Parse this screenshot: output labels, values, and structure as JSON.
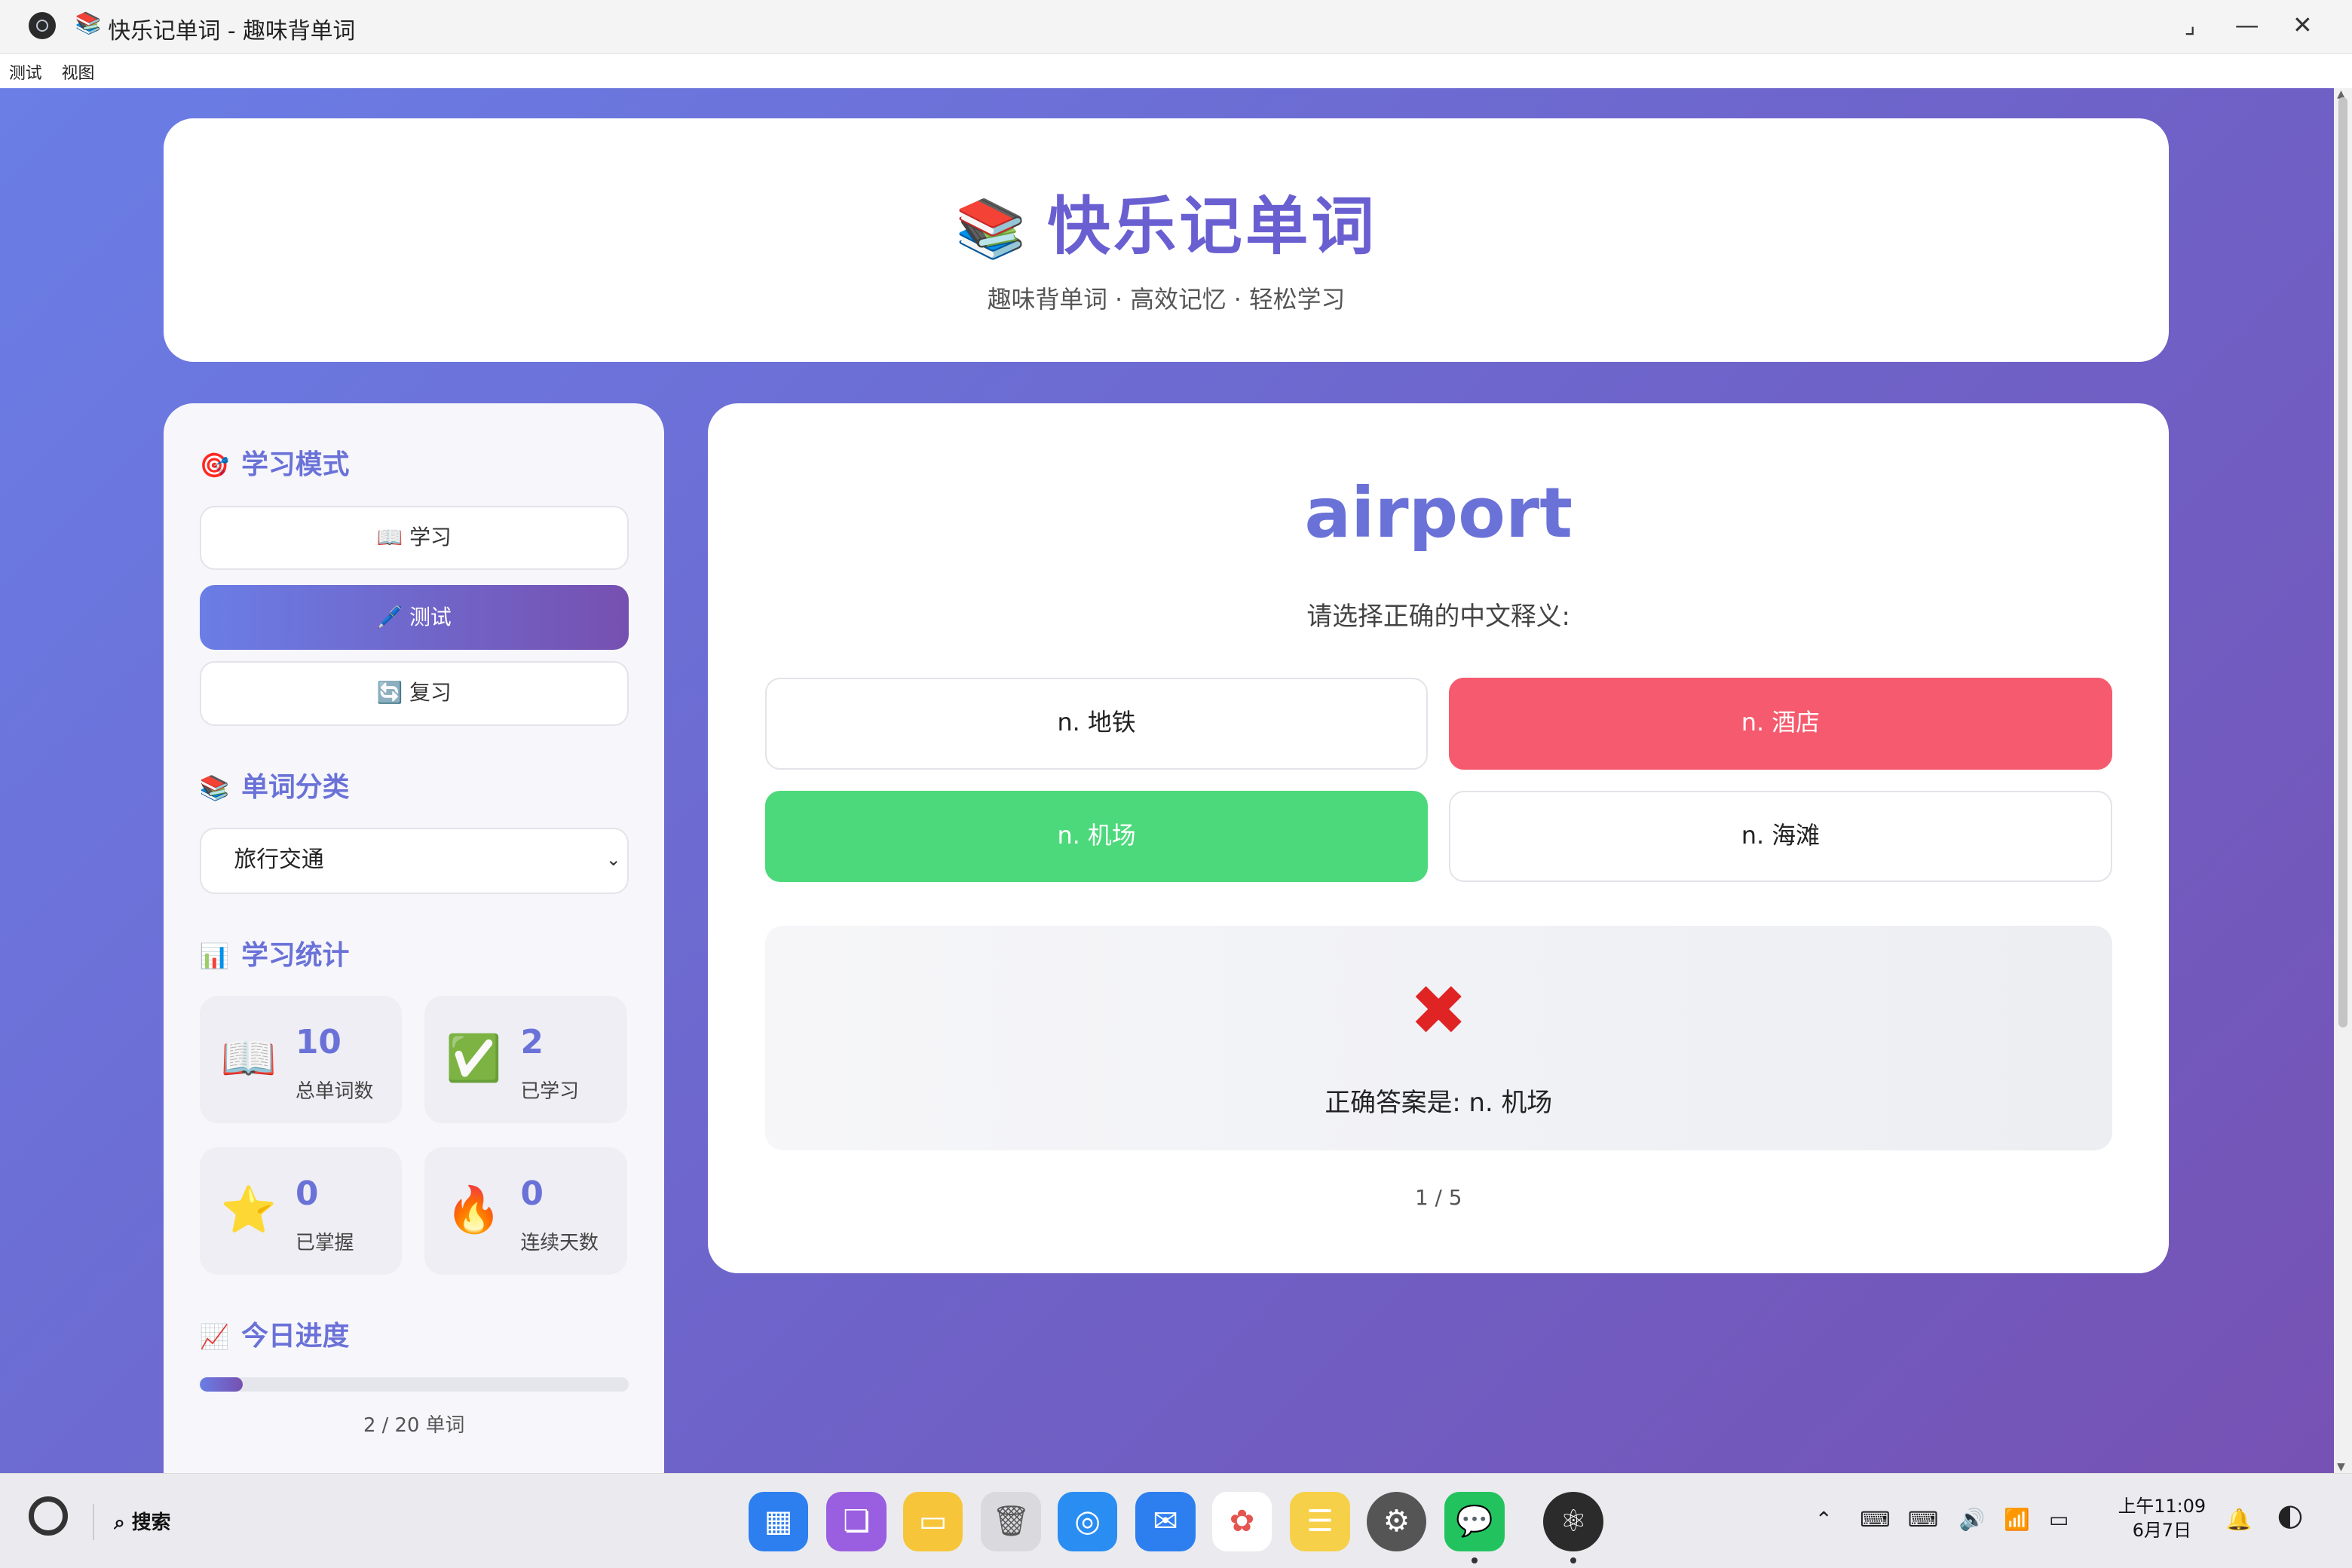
{
  "window": {
    "title": "快乐记单词 - 趣味背单词",
    "title_emoji": "📚"
  },
  "menu": [
    "测试",
    "视图"
  ],
  "header": {
    "icon": "📚",
    "title": "快乐记单词",
    "subtitle": "趣味背单词 · 高效记忆 · 轻松学习"
  },
  "sidebar": {
    "mode_section": {
      "icon": "🎯",
      "title": "学习模式"
    },
    "modes": [
      {
        "icon": "📖",
        "label": "学习",
        "active": false
      },
      {
        "icon": "🖊️",
        "label": "测试",
        "active": true
      },
      {
        "icon": "🔄",
        "label": "复习",
        "active": false
      }
    ],
    "category_section": {
      "icon": "📚",
      "title": "单词分类"
    },
    "category_selected": "旅行交通",
    "stats_section": {
      "icon": "📊",
      "title": "学习统计"
    },
    "stats": [
      {
        "icon": "📖",
        "value": "10",
        "label": "总单词数"
      },
      {
        "icon": "✅",
        "value": "2",
        "label": "已学习"
      },
      {
        "icon": "⭐",
        "value": "0",
        "label": "已掌握"
      },
      {
        "icon": "🔥",
        "value": "0",
        "label": "连续天数"
      }
    ],
    "progress_section": {
      "icon": "📈",
      "title": "今日进度"
    },
    "progress": {
      "fraction": 0.1,
      "text": "2 / 20 单词"
    }
  },
  "quiz": {
    "word": "airport",
    "prompt": "请选择正确的中文释义:",
    "options": [
      {
        "text": "n. 地铁",
        "state": "normal"
      },
      {
        "text": "n. 酒店",
        "state": "wrong"
      },
      {
        "text": "n. 机场",
        "state": "correct"
      },
      {
        "text": "n. 海滩",
        "state": "normal"
      }
    ],
    "feedback": {
      "icon": "✖",
      "text": "正确答案是: n. 机场"
    },
    "counter": "1 / 5"
  },
  "taskbar": {
    "search_label": "搜索",
    "clock_time": "上午11:09",
    "clock_date": "6月7日"
  },
  "colors": {
    "accent": "#6a72d8",
    "wrong": "#f55a6e",
    "correct": "#4cd97b"
  }
}
